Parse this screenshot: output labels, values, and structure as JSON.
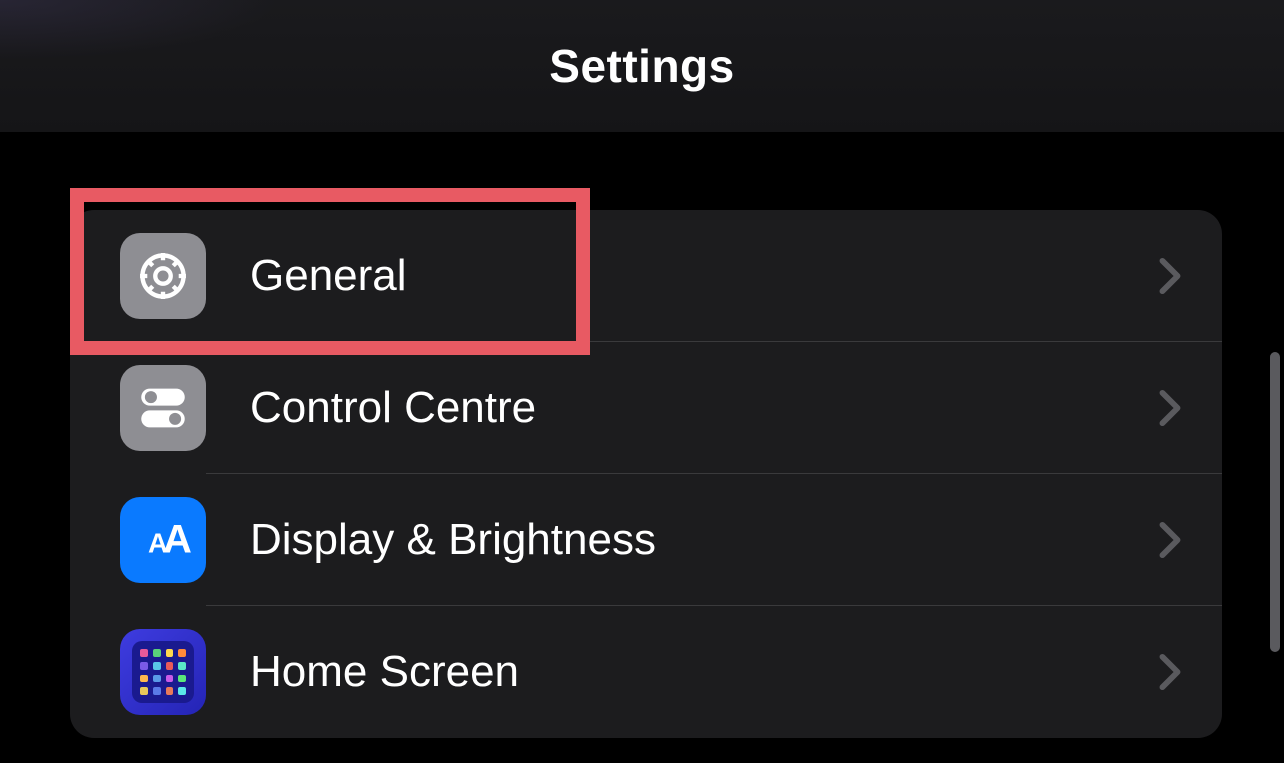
{
  "header": {
    "title": "Settings"
  },
  "items": [
    {
      "id": "general",
      "label": "General",
      "icon": "gear-icon",
      "highlighted": true
    },
    {
      "id": "control-centre",
      "label": "Control Centre",
      "icon": "toggles-icon",
      "highlighted": false
    },
    {
      "id": "display-brightness",
      "label": "Display & Brightness",
      "icon": "text-size-icon",
      "highlighted": false
    },
    {
      "id": "home-screen",
      "label": "Home Screen",
      "icon": "app-grid-icon",
      "highlighted": false
    }
  ]
}
